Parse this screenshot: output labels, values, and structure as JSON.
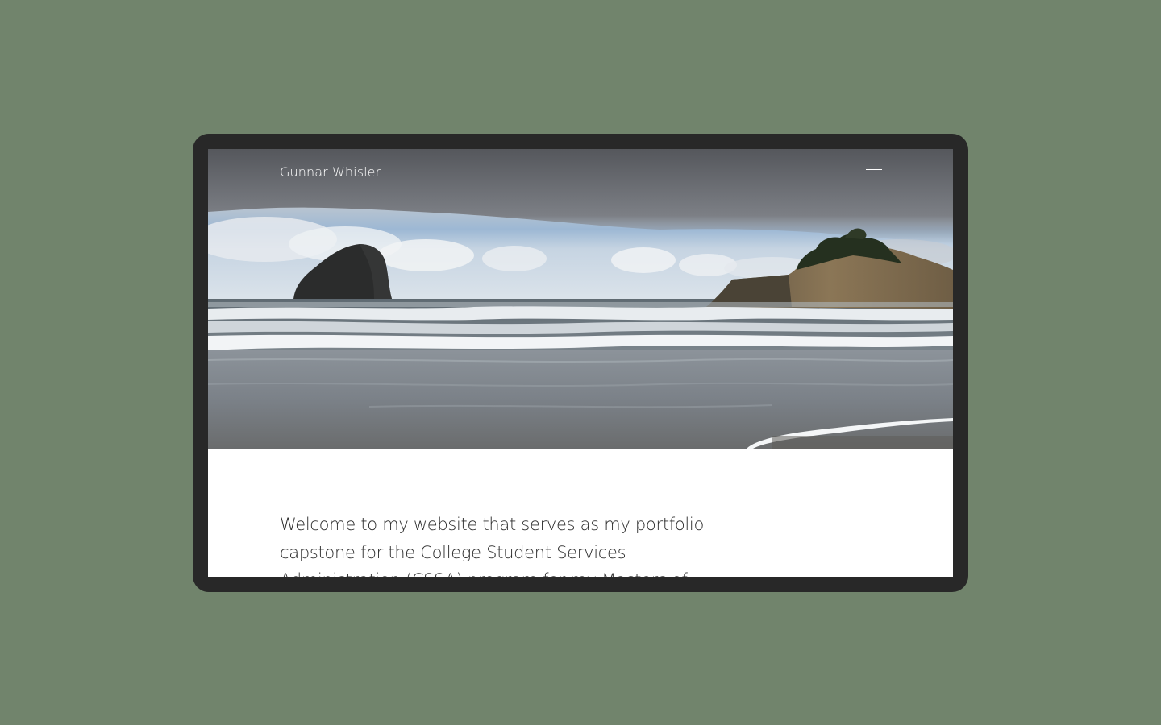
{
  "site": {
    "title": "Gunnar Whisler"
  },
  "header": {
    "menu_icon": "hamburger-menu-icon"
  },
  "hero": {
    "image": "coastal-beach-sea-stack-photo"
  },
  "intro": {
    "text": "Welcome to my website that serves as my portfolio capstone for the College Student Services Administration (CSSA) program for my Masters of"
  },
  "colors": {
    "page_background": "#71846c",
    "device_frame": "#282828",
    "screen_background": "#ffffff",
    "body_text": "#2e2e2e",
    "header_text": "#ffffff"
  }
}
